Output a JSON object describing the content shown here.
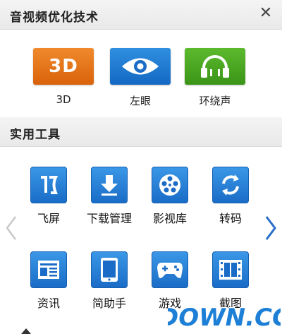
{
  "header": {
    "title": "音视频优化技术",
    "close_glyph": "✕"
  },
  "enhancements": [
    {
      "id": "3d",
      "button_text": "3D",
      "label": "3D",
      "color": "#e87418",
      "icon": "3d-icon"
    },
    {
      "id": "eye",
      "label": "左眼",
      "color": "#1f7bd3",
      "icon": "eye-icon"
    },
    {
      "id": "surround",
      "label": "环绕声",
      "color": "#4aa823",
      "icon": "headphones-icon"
    }
  ],
  "tools_header": {
    "title": "实用工具"
  },
  "tools": [
    {
      "label": "飞屏",
      "icon": "flying-screen-icon"
    },
    {
      "label": "下载管理",
      "icon": "download-icon"
    },
    {
      "label": "影视库",
      "icon": "film-reel-icon"
    },
    {
      "label": "转码",
      "icon": "refresh-icon"
    },
    {
      "label": "资讯",
      "icon": "news-icon"
    },
    {
      "label": "简助手",
      "icon": "tablet-icon"
    },
    {
      "label": "游戏",
      "icon": "gamepad-icon"
    },
    {
      "label": "截图",
      "icon": "filmstrip-icon"
    }
  ],
  "watermark": {
    "text": "DOWN.CC"
  }
}
